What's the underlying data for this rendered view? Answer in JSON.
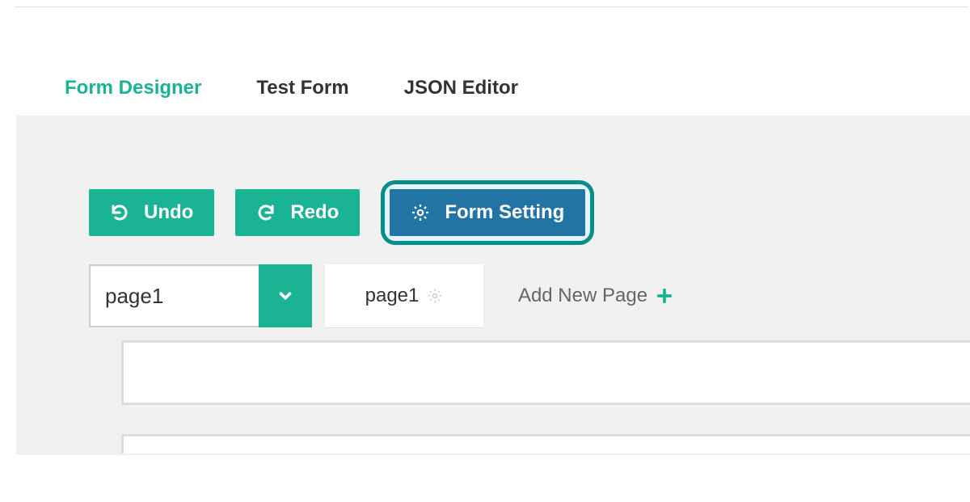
{
  "tabs": {
    "form_designer": "Form Designer",
    "test_form": "Test Form",
    "json_editor": "JSON Editor"
  },
  "toolbar": {
    "undo_label": "Undo",
    "redo_label": "Redo",
    "form_setting_label": "Form Setting"
  },
  "pages": {
    "selected": "page1",
    "current_tab": "page1",
    "add_label": "Add New Page"
  }
}
